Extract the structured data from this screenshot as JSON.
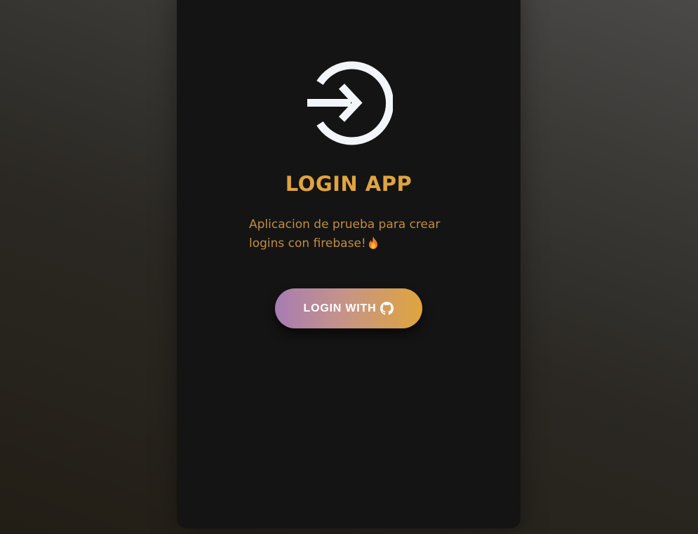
{
  "app": {
    "title": "LOGIN APP",
    "description": "Aplicacion de prueba para crear logins con firebase!",
    "description_emoji_icon": "fire-icon",
    "logo_icon": "login-enter-icon"
  },
  "login_button": {
    "label": "LOGIN WITH",
    "provider_icon": "github-icon"
  },
  "colors": {
    "accent": "#e0a43f",
    "description_text": "#c08d40",
    "card_background": "#141414",
    "button_gradient_start": "#a77cb3",
    "button_gradient_end": "#dfa53d",
    "logo": "#f2f6fb"
  }
}
